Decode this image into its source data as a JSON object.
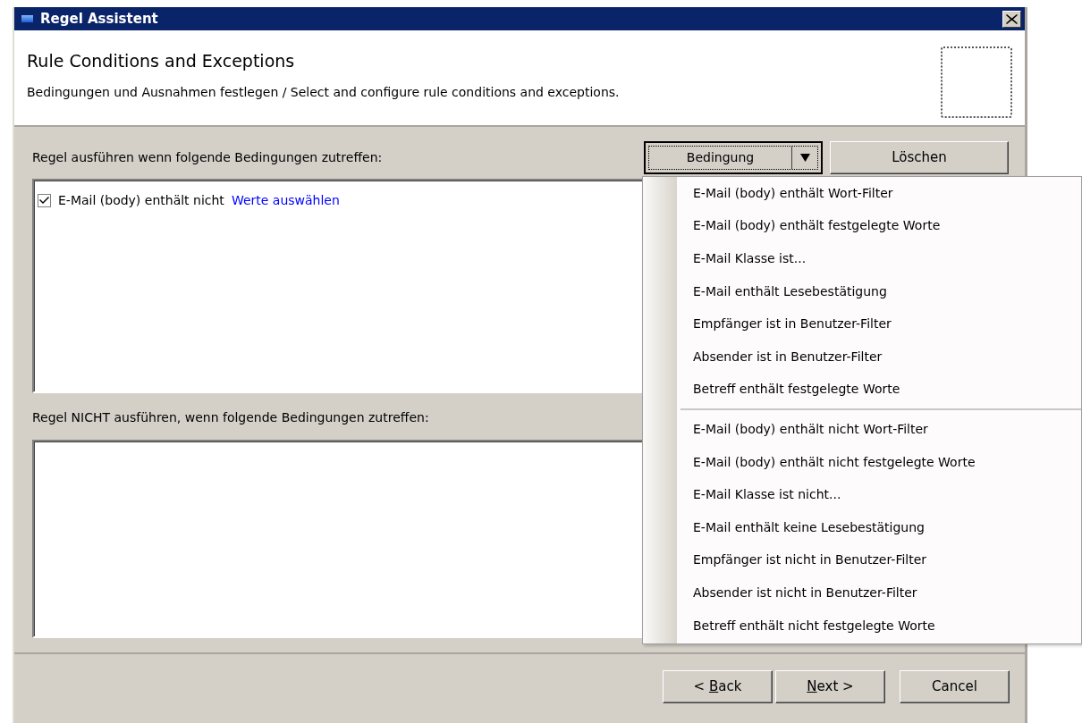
{
  "window": {
    "title": "Regel Assistent"
  },
  "header": {
    "title": "Rule Conditions and Exceptions",
    "subtitle": "Bedingungen und Ausnahmen festlegen / Select and configure rule conditions and exceptions."
  },
  "conditions": {
    "label": "Regel ausführen wenn folgende Bedingungen zutreffen:",
    "items": [
      {
        "text": "E-Mail (body) enthält nicht",
        "link": "Werte auswählen",
        "checked": true
      }
    ]
  },
  "toolbar": {
    "add_button": "Bedingung",
    "delete_button": "Löschen"
  },
  "exceptions": {
    "label": "Regel NICHT ausführen, wenn folgende Bedingungen zutreffen:"
  },
  "menu": {
    "groups": [
      [
        "E-Mail (body) enthält Wort-Filter",
        "E-Mail (body) enthält festgelegte Worte",
        "E-Mail Klasse ist...",
        "E-Mail enthält Lesebestätigung",
        "Empfänger ist in Benutzer-Filter",
        "Absender ist in Benutzer-Filter",
        "Betreff enthält festgelegte Worte"
      ],
      [
        "E-Mail (body) enthält nicht Wort-Filter",
        "E-Mail (body) enthält nicht festgelegte Worte",
        "E-Mail Klasse ist nicht...",
        "E-Mail enthält keine Lesebestätigung",
        "Empfänger ist nicht in Benutzer-Filter",
        "Absender ist nicht in Benutzer-Filter",
        "Betreff enthält nicht festgelegte Worte"
      ]
    ]
  },
  "footer": {
    "buttons": [
      {
        "prefix": "< ",
        "access_key": "B",
        "rest": "ack"
      },
      {
        "access_key": "N",
        "rest": "ext >"
      },
      {
        "rest": "Cancel"
      }
    ]
  }
}
